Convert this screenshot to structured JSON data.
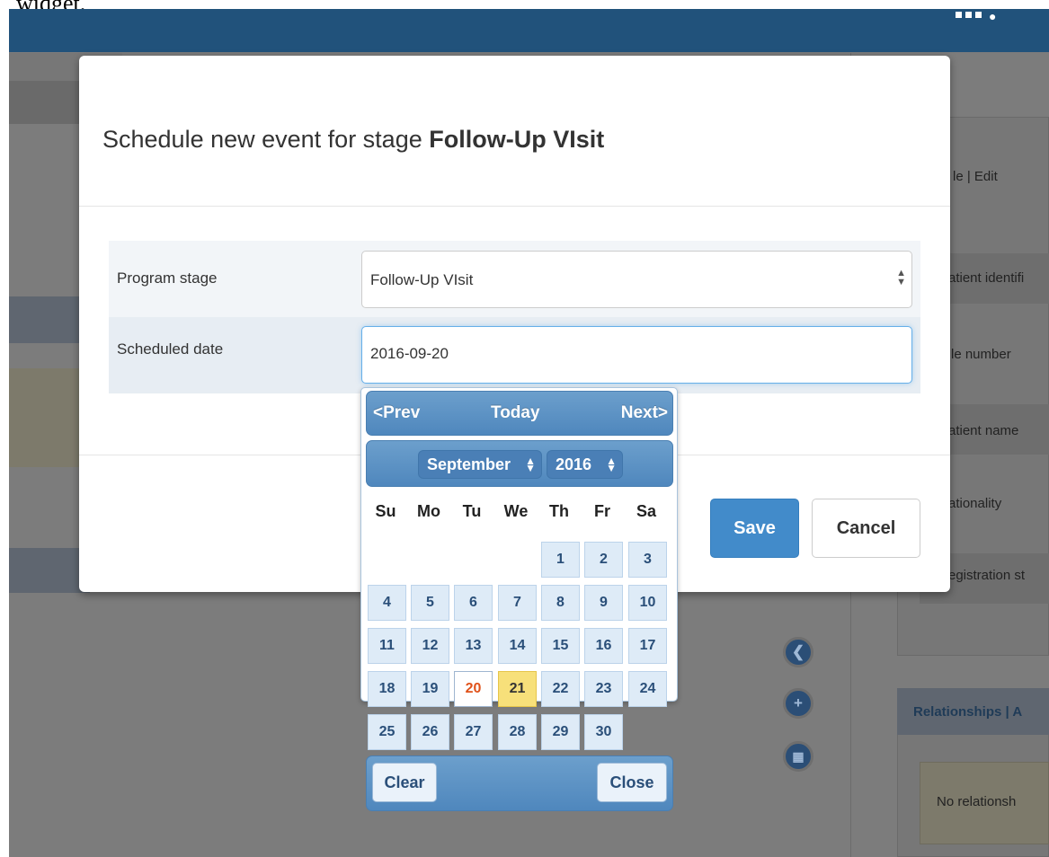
{
  "caption": "widget.",
  "modal": {
    "title_prefix": "Schedule new event for stage ",
    "title_stage": "Follow-Up VIsit",
    "form": {
      "program_stage_label": "Program stage",
      "program_stage_value": "Follow-Up VIsit",
      "scheduled_date_label": "Scheduled date",
      "scheduled_date_value": "2016-09-20"
    },
    "save_label": "Save",
    "cancel_label": "Cancel"
  },
  "datepicker": {
    "prev_label": "<Prev",
    "today_label": "Today",
    "next_label": "Next>",
    "month_value": "September",
    "year_value": "2016",
    "weekdays": [
      "Su",
      "Mo",
      "Tu",
      "We",
      "Th",
      "Fr",
      "Sa"
    ],
    "days": [
      "1",
      "2",
      "3",
      "4",
      "5",
      "6",
      "7",
      "8",
      "9",
      "10",
      "11",
      "12",
      "13",
      "14",
      "15",
      "16",
      "17",
      "18",
      "19",
      "20",
      "21",
      "22",
      "23",
      "24",
      "25",
      "26",
      "27",
      "28",
      "29",
      "30"
    ],
    "selected_day": "20",
    "today_day": "21",
    "clear_label": "Clear",
    "close_label": "Close",
    "colors": {
      "header": "#5b92c4",
      "cell": "#deebf7",
      "selected_text": "#e0521a",
      "today_bg": "#f7e07a"
    }
  },
  "background": {
    "right_panel_header": "le | Edit",
    "right_rows": [
      "atient identifi",
      "le number",
      "atient name",
      "ationality",
      "egistration st"
    ],
    "relationships_header": "Relationships | A",
    "no_relationships": "No relationsh",
    "side_buttons": [
      "chevron-left-icon",
      "plus-icon",
      "calendar-icon"
    ]
  }
}
